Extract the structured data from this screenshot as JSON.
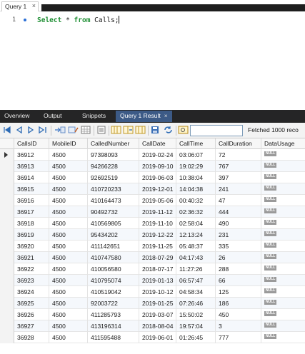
{
  "query_tab": {
    "label": "Query 1",
    "close": "×"
  },
  "editor": {
    "line_number": "1",
    "keyword_select": "Select",
    "star": "*",
    "keyword_from": "from",
    "table_name": "Calls;"
  },
  "panel_tabs": {
    "overview": "Overview",
    "output": "Output",
    "snippets": "Snippets",
    "result": "Query 1 Result",
    "close": "×"
  },
  "toolbar": {
    "icons": [
      "first-record-icon",
      "previous-record-icon",
      "next-record-icon",
      "last-record-icon",
      "insert-row-icon",
      "edit-row-icon",
      "grid-view-icon",
      "sort-icon",
      "filter-icon",
      "column-chooser-icon",
      "save-icon",
      "refresh-icon",
      "find-icon"
    ],
    "search_value": "",
    "fetched_text": "Fetched 1000 reco"
  },
  "grid": {
    "columns": [
      "CallsID",
      "MobileID",
      "CalledNumber",
      "CallDate",
      "CallTime",
      "CallDuration",
      "DataUsage"
    ],
    "null_label": "NULL",
    "rows": [
      [
        "36912",
        "4500",
        "97398093",
        "2019-02-24",
        "03:06:07",
        "72"
      ],
      [
        "36913",
        "4500",
        "94266228",
        "2019-09-10",
        "19:02:29",
        "767"
      ],
      [
        "36914",
        "4500",
        "92692519",
        "2019-06-03",
        "10:38:04",
        "397"
      ],
      [
        "36915",
        "4500",
        "410720233",
        "2019-12-01",
        "14:04:38",
        "241"
      ],
      [
        "36916",
        "4500",
        "410164473",
        "2019-05-06",
        "00:40:32",
        "47"
      ],
      [
        "36917",
        "4500",
        "90492732",
        "2019-11-12",
        "02:36:32",
        "444"
      ],
      [
        "36918",
        "4500",
        "410569805",
        "2019-11-10",
        "02:58:04",
        "490"
      ],
      [
        "36919",
        "4500",
        "95434202",
        "2019-12-22",
        "12:13:24",
        "231"
      ],
      [
        "36920",
        "4500",
        "411142651",
        "2019-11-25",
        "05:48:37",
        "335"
      ],
      [
        "36921",
        "4500",
        "410747580",
        "2018-07-29",
        "04:17:43",
        "26"
      ],
      [
        "36922",
        "4500",
        "410056580",
        "2018-07-17",
        "11:27:26",
        "288"
      ],
      [
        "36923",
        "4500",
        "410795074",
        "2019-01-13",
        "06:57:47",
        "66"
      ],
      [
        "36924",
        "4500",
        "410519042",
        "2019-10-12",
        "04:58:34",
        "125"
      ],
      [
        "36925",
        "4500",
        "92003722",
        "2019-01-25",
        "07:26:46",
        "186"
      ],
      [
        "36926",
        "4500",
        "411285793",
        "2019-03-07",
        "15:50:02",
        "450"
      ],
      [
        "36927",
        "4500",
        "413196314",
        "2018-08-04",
        "19:57:04",
        "3"
      ],
      [
        "36928",
        "4500",
        "411595488",
        "2019-06-01",
        "01:26:45",
        "777"
      ]
    ]
  },
  "colors": {
    "keyword": "#1f8f34",
    "panel_bar": "#252526",
    "active_tab": "#3c5a86",
    "null_badge": "#9a9a9a"
  }
}
